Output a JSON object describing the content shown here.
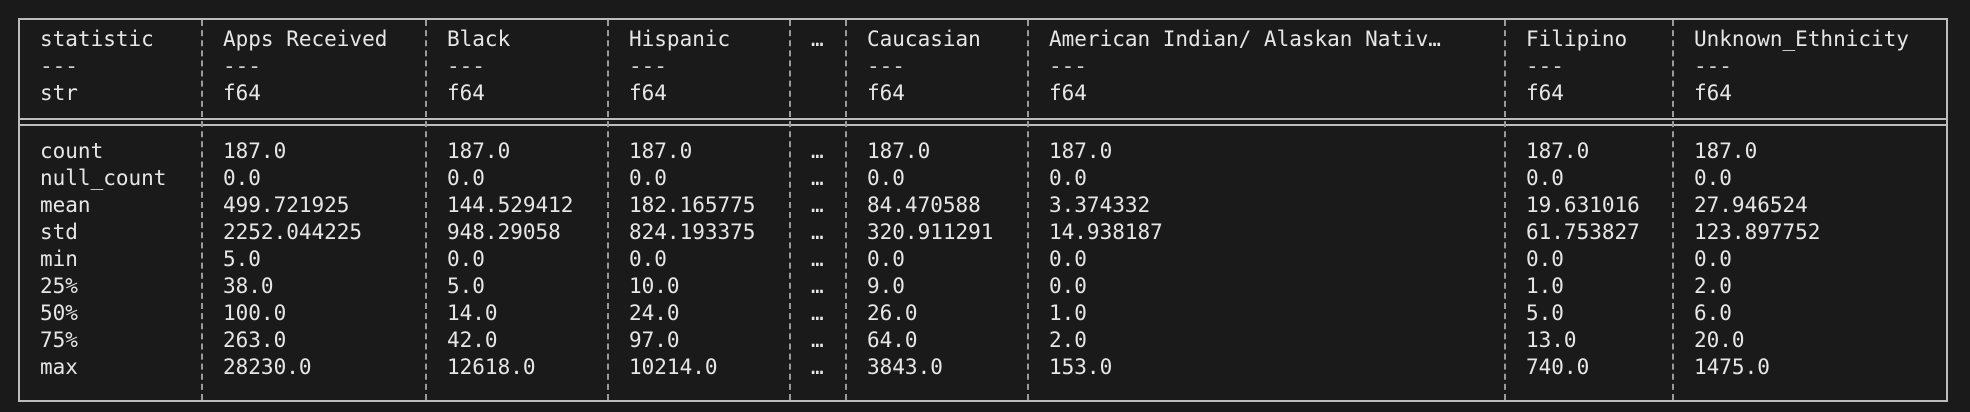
{
  "table": {
    "columns": [
      {
        "name": "statistic",
        "sep": "---",
        "dtype": "str"
      },
      {
        "name": "Apps Received",
        "sep": "---",
        "dtype": "f64"
      },
      {
        "name": "Black",
        "sep": "---",
        "dtype": "f64"
      },
      {
        "name": "Hispanic",
        "sep": "---",
        "dtype": "f64"
      },
      {
        "name": "…",
        "sep": "",
        "dtype": ""
      },
      {
        "name": "Caucasian",
        "sep": "---",
        "dtype": "f64"
      },
      {
        "name": "American Indian/ Alaskan Nativ…",
        "sep": "---",
        "dtype": "f64"
      },
      {
        "name": "Filipino",
        "sep": "---",
        "dtype": "f64"
      },
      {
        "name": "Unknown_Ethnicity",
        "sep": "---",
        "dtype": "f64"
      }
    ],
    "rows": [
      [
        "count",
        "187.0",
        "187.0",
        "187.0",
        "…",
        "187.0",
        "187.0",
        "187.0",
        "187.0"
      ],
      [
        "null_count",
        "0.0",
        "0.0",
        "0.0",
        "…",
        "0.0",
        "0.0",
        "0.0",
        "0.0"
      ],
      [
        "mean",
        "499.721925",
        "144.529412",
        "182.165775",
        "…",
        "84.470588",
        "3.374332",
        "19.631016",
        "27.946524"
      ],
      [
        "std",
        "2252.044225",
        "948.29058",
        "824.193375",
        "…",
        "320.911291",
        "14.938187",
        "61.753827",
        "123.897752"
      ],
      [
        "min",
        "5.0",
        "0.0",
        "0.0",
        "…",
        "0.0",
        "0.0",
        "0.0",
        "0.0"
      ],
      [
        "25%",
        "38.0",
        "5.0",
        "10.0",
        "…",
        "9.0",
        "0.0",
        "1.0",
        "2.0"
      ],
      [
        "50%",
        "100.0",
        "14.0",
        "24.0",
        "…",
        "26.0",
        "1.0",
        "5.0",
        "6.0"
      ],
      [
        "75%",
        "263.0",
        "42.0",
        "97.0",
        "…",
        "64.0",
        "2.0",
        "13.0",
        "20.0"
      ],
      [
        "max",
        "28230.0",
        "12618.0",
        "10214.0",
        "…",
        "3843.0",
        "153.0",
        "740.0",
        "1475.0"
      ]
    ]
  }
}
